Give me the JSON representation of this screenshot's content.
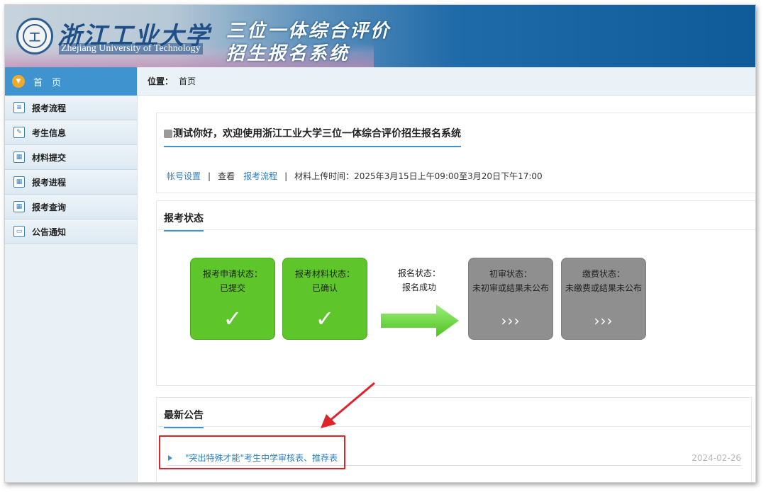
{
  "header": {
    "seal_text": "工",
    "brand_cn": "浙江工业大学",
    "brand_en": "Zhejiang University of Technology",
    "title_line1": "三位一体综合评价",
    "title_line2": "招生报名系统"
  },
  "sidebar": {
    "home_label": "首　页",
    "items": [
      {
        "label": "报考流程",
        "icon": "list-icon"
      },
      {
        "label": "考生信息",
        "icon": "edit-icon"
      },
      {
        "label": "材料提交",
        "icon": "calendar-icon"
      },
      {
        "label": "报考进程",
        "icon": "calendar-icon"
      },
      {
        "label": "报考查询",
        "icon": "calendar-icon"
      },
      {
        "label": "公告通知",
        "icon": "chat-icon"
      }
    ]
  },
  "breadcrumb": {
    "label": "位置：",
    "current": "首页"
  },
  "welcome": {
    "greeting": "测试你好，欢迎使用浙江工业大学三位一体综合评价招生报名系统",
    "account_link": "帐号设置",
    "sep": "|",
    "view_label": "查看",
    "process_link": "报考流程",
    "upload_time": "材料上传时间：2025年3月15日上午09:00至3月20日下午17:00"
  },
  "status": {
    "title": "报考状态",
    "apply": {
      "label": "报考申请状态：",
      "value": "已提交"
    },
    "material": {
      "label": "报考材料状态：",
      "value": "已确认"
    },
    "register": {
      "label": "报名状态：",
      "value": "报名成功"
    },
    "first_review": {
      "label": "初审状态：",
      "value": "未初审或结果未公布"
    },
    "payment": {
      "label": "缴费状态：",
      "value": "未缴费或结果未公布"
    },
    "check_mark": "✓",
    "pending_mark": "›››"
  },
  "notices": {
    "title": "最新公告",
    "items": [
      {
        "title": "\"突出特殊才能\"考生中学审核表、推荐表",
        "date": "2024-02-26"
      }
    ]
  },
  "colors": {
    "accent": "#3f93cf",
    "success": "#5ec62a",
    "pending": "#8f8f8f",
    "highlight": "#e0222b"
  }
}
